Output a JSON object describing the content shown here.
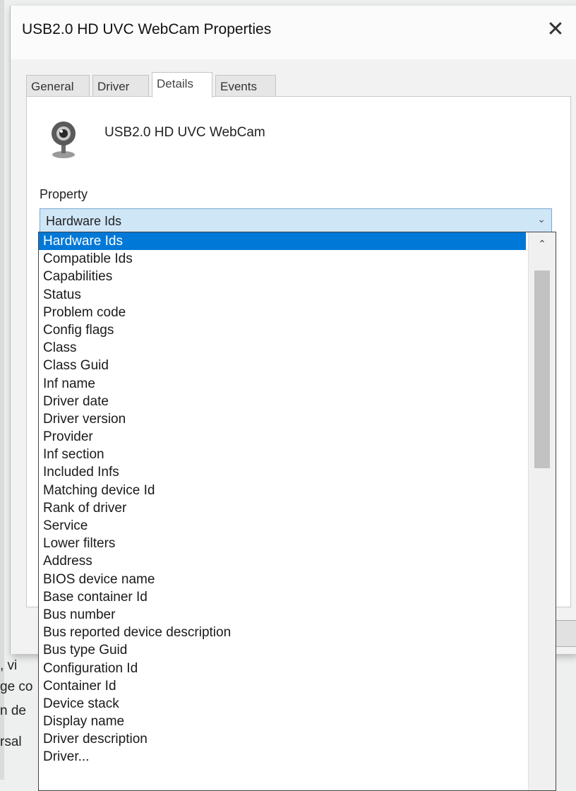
{
  "window": {
    "title": "USB2.0 HD UVC WebCam Properties",
    "close_glyph": "✕"
  },
  "tabs": [
    "General",
    "Driver",
    "Details",
    "Events"
  ],
  "active_tab": "Details",
  "device": {
    "name": "USB2.0 HD UVC WebCam",
    "icon": "webcam-icon"
  },
  "property": {
    "label": "Property",
    "selected": "Hardware Ids",
    "arrow_glyph": "⌄"
  },
  "dropdown": {
    "items": [
      "Hardware Ids",
      "Compatible Ids",
      "Capabilities",
      "Status",
      "Problem code",
      "Config flags",
      "Class",
      "Class Guid",
      "Inf name",
      "Driver date",
      "Driver version",
      "Provider",
      "Inf section",
      "Included Infs",
      "Matching device Id",
      "Rank of driver",
      "Service",
      "Lower filters",
      "Address",
      "BIOS device name",
      "Base container Id",
      "Bus number",
      "Bus reported device description",
      "Bus type Guid",
      "Configuration Id",
      "Container Id",
      "Device stack",
      "Display name",
      "Driver description",
      "Driver..."
    ],
    "scroll_up_glyph": "⌃"
  },
  "background": {
    "fragments": [
      ", vi",
      "ge co",
      "n de",
      "rsal"
    ]
  },
  "colors": {
    "selection": "#0078d7",
    "combo_fill": "#cfe6f7",
    "combo_border": "#7aa9d1"
  }
}
